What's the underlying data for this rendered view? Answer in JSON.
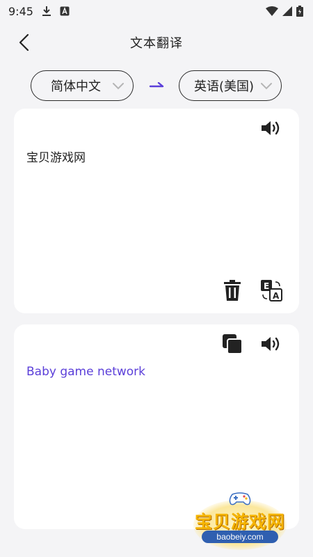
{
  "status_bar": {
    "time": "9:45"
  },
  "header": {
    "title": "文本翻译"
  },
  "languages": {
    "source": "简体中文",
    "target": "英语(美国)"
  },
  "input": {
    "text": "宝贝游戏网"
  },
  "output": {
    "text": "Baby game network"
  },
  "watermark": {
    "title": "宝贝游戏网",
    "url": "baobeiy.com"
  },
  "colors": {
    "accent": "#5b3fd9",
    "background": "#f4f4f6",
    "card": "#ffffff"
  },
  "icons": {
    "status": [
      "download-icon",
      "a-box-icon",
      "wifi-icon",
      "signal-icon",
      "battery-icon"
    ],
    "header": [
      "back-arrow-icon"
    ],
    "input_card": [
      "speaker-icon",
      "trash-icon",
      "translate-icon"
    ],
    "output_card": [
      "copy-icon",
      "speaker-icon"
    ]
  }
}
